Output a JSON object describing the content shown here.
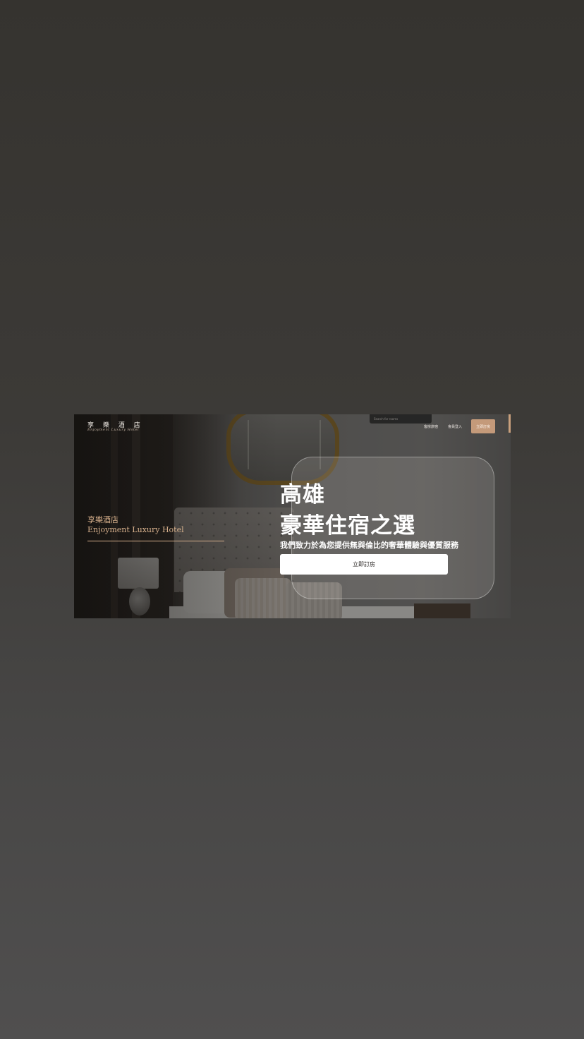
{
  "header": {
    "logo_title": "享 樂 酒 店",
    "logo_subtitle": "Enjoyment Luxury Hotel",
    "search_placeholder": "Search for rooms",
    "nav_rooms": "客房旅宿",
    "nav_login": "會員登入",
    "book_button": "立即訂房"
  },
  "brand": {
    "name_zh": "享樂酒店",
    "name_en": "Enjoyment Luxury Hotel"
  },
  "hero": {
    "headline_line1": "高雄",
    "headline_line2": "豪華住宿之選",
    "tagline": "我們致力於為您提供無與倫比的奢華體驗與優質服務",
    "cta_label": "立即訂房"
  },
  "colors": {
    "accent": "#c49a7a",
    "brand_gold": "#d7b08c",
    "page_background": "#3c3a37"
  }
}
